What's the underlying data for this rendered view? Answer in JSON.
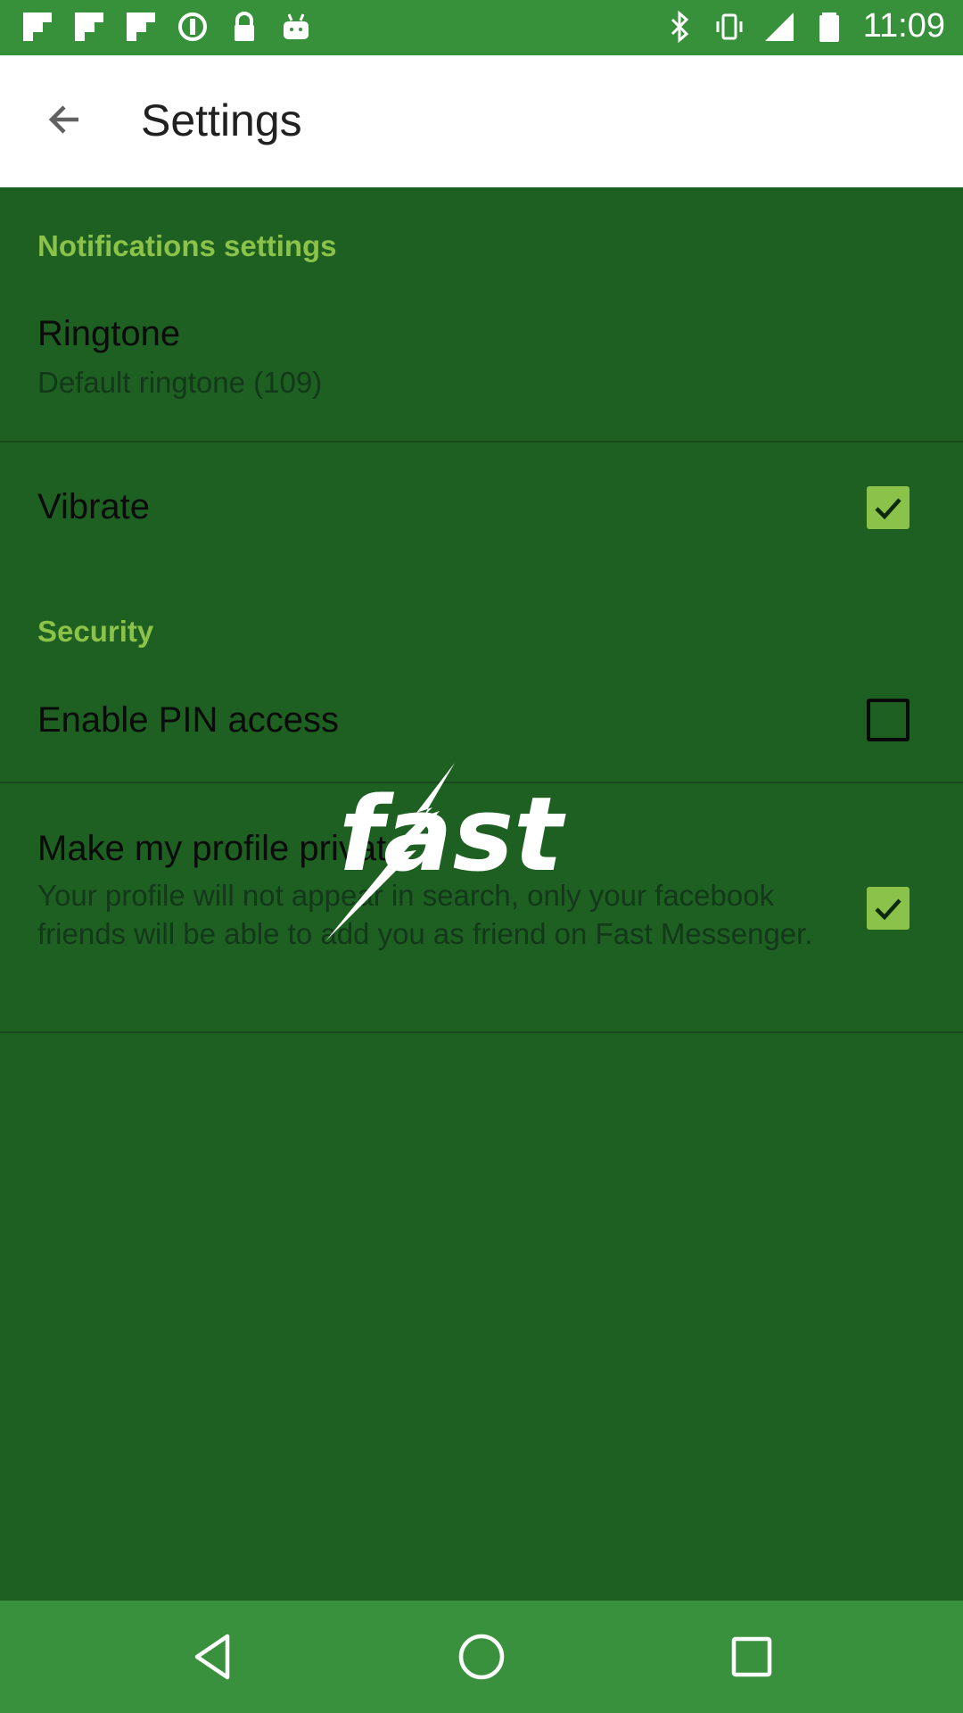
{
  "status_bar": {
    "time": "11:09",
    "left_icons": [
      "flipboard-icon",
      "flipboard-icon",
      "flipboard-icon",
      "sync-icon",
      "lock-icon",
      "android-icon"
    ],
    "right_icons": [
      "bluetooth-icon",
      "vibrate-icon",
      "signal-icon",
      "battery-icon"
    ]
  },
  "app_bar": {
    "title": "Settings",
    "back_icon": "arrow-back-icon"
  },
  "notifications": {
    "header": "Notifications settings",
    "ringtone": {
      "title": "Ringtone",
      "summary": "Default ringtone (109)"
    },
    "vibrate": {
      "title": "Vibrate",
      "checked": true
    }
  },
  "security": {
    "header": "Security",
    "pin": {
      "title": "Enable PIN access",
      "checked": false
    },
    "private": {
      "title": "Make my profile private",
      "summary": "Your profile will not appear in search, only your facebook friends will be able to add you as friend on Fast Messenger.",
      "checked": true
    }
  },
  "watermark": {
    "text": "fast"
  },
  "nav_bar": {
    "buttons": [
      "back",
      "home",
      "recents"
    ]
  },
  "colors": {
    "status_bar": "#37903a",
    "content_bg": "#1e5f22",
    "accent": "#8bc34a",
    "nav_bar": "#3a913d"
  }
}
